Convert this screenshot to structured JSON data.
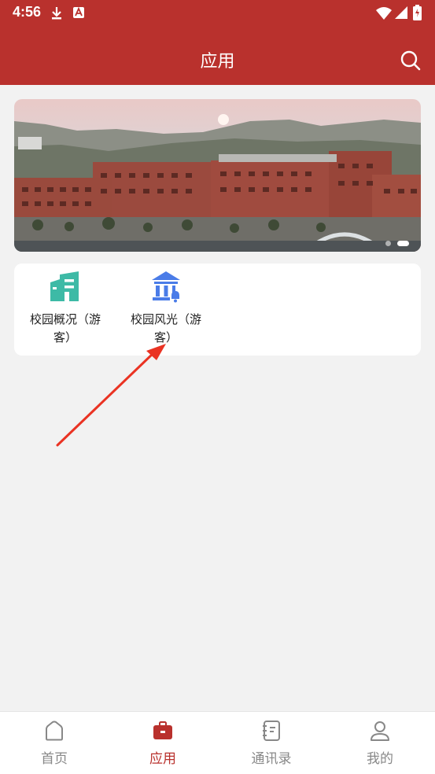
{
  "status_bar": {
    "time": "4:56",
    "icons": [
      "download-icon",
      "text-icon",
      "wifi-icon",
      "signal-icon",
      "battery-icon"
    ]
  },
  "header": {
    "title": "应用",
    "search_icon": "search-icon"
  },
  "banner": {
    "image": "campus-photo",
    "page_count": 2,
    "active_page": 2
  },
  "apps": [
    {
      "label": "校园概况（游客）",
      "icon": "building-icon",
      "icon_color": "#3dbaa6"
    },
    {
      "label": "校园风光（游客）",
      "icon": "museum-bell-icon",
      "icon_color": "#4a7ce8"
    }
  ],
  "bottom_nav": {
    "items": [
      {
        "label": "首页",
        "icon": "home-icon"
      },
      {
        "label": "应用",
        "icon": "briefcase-icon",
        "active": true
      },
      {
        "label": "通讯录",
        "icon": "contacts-icon"
      },
      {
        "label": "我的",
        "icon": "user-icon"
      }
    ]
  },
  "colors": {
    "brand": "#b9312d",
    "background": "#f2f2f2",
    "inactive": "#888888",
    "annotation_arrow": "#ea3323"
  }
}
